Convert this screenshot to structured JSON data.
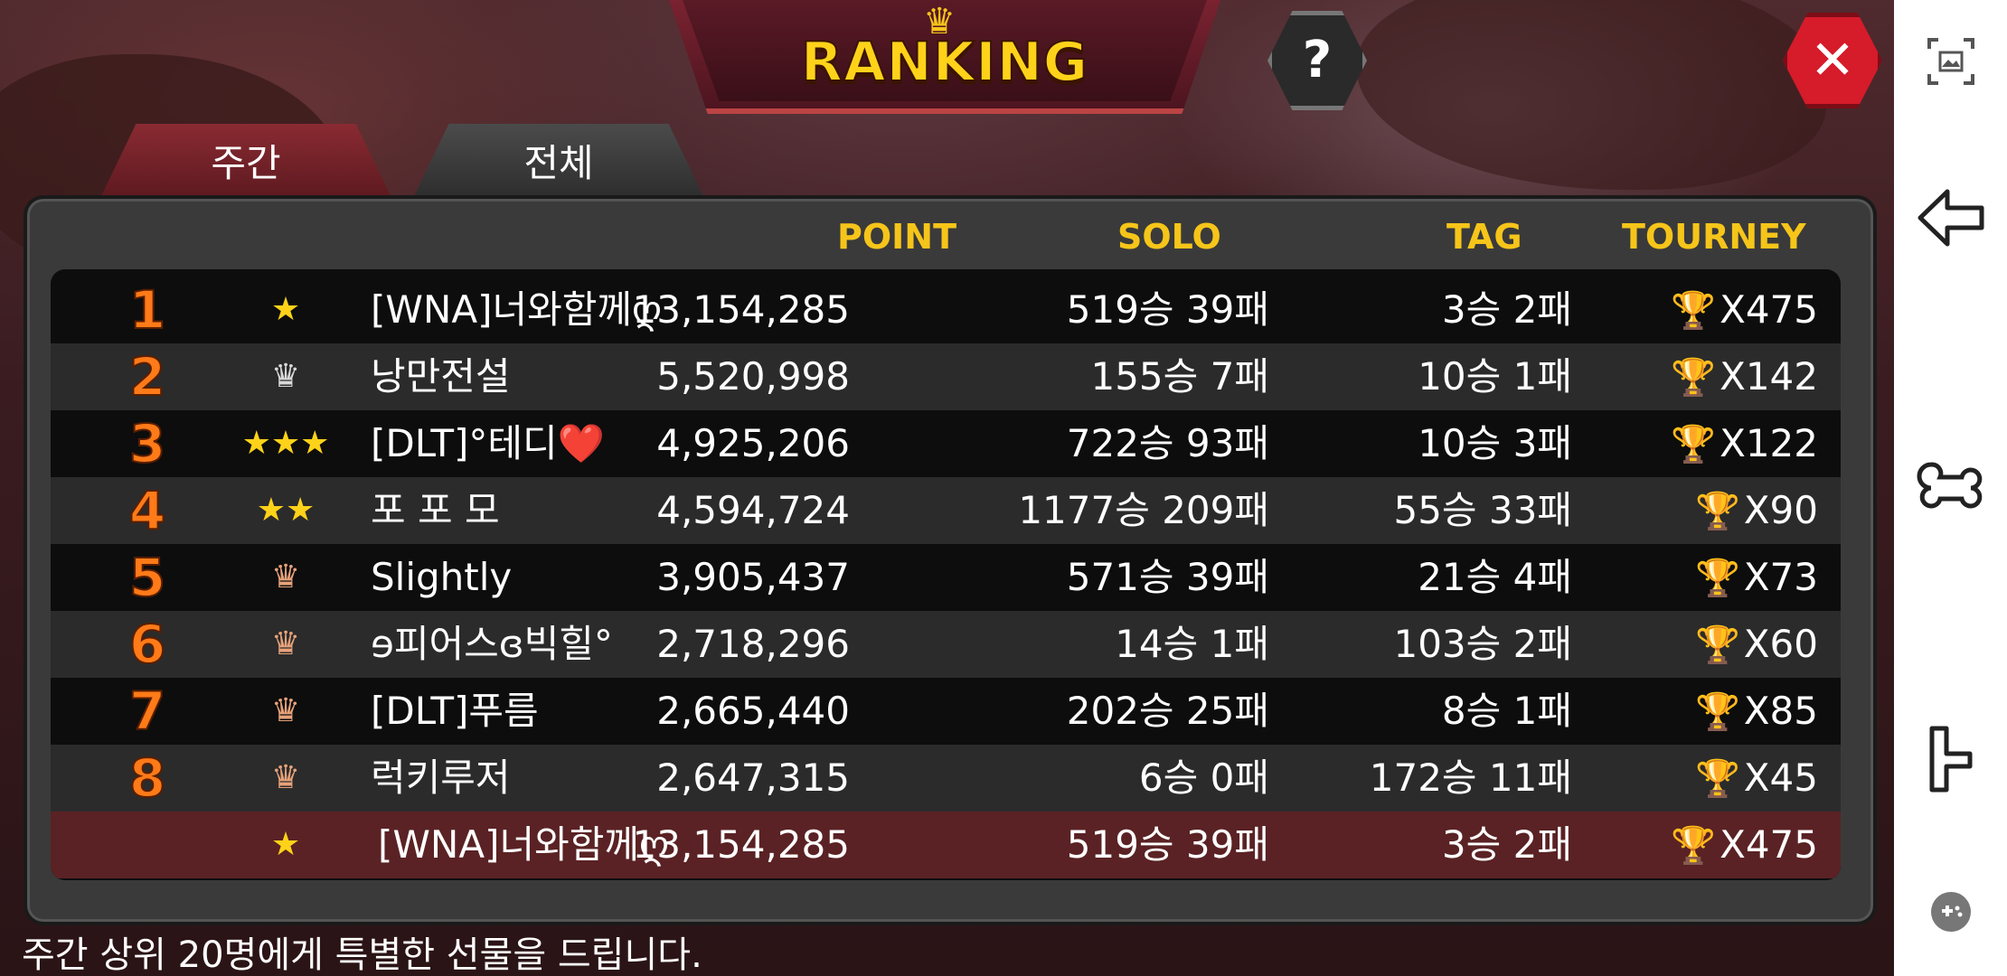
{
  "header": {
    "title": "RANKING",
    "help": "?",
    "close": "✕"
  },
  "tabs": [
    {
      "label": "주간"
    },
    {
      "label": "전체"
    }
  ],
  "columns": {
    "point": "POINT",
    "solo": "SOLO",
    "tag": "TAG",
    "tourney": "TOURNEY"
  },
  "rows": [
    {
      "rank": "1",
      "badge": "★",
      "badge_type": "star",
      "name": "[WNA]너와함께ღ",
      "point": "13,154,285",
      "solo": "519승 39패",
      "tag": "3승 2패",
      "tourney": "X475"
    },
    {
      "rank": "2",
      "badge": "♛",
      "badge_type": "crown-silver",
      "name": "낭만전설",
      "point": "5,520,998",
      "solo": "155승 7패",
      "tag": "10승 1패",
      "tourney": "X142"
    },
    {
      "rank": "3",
      "badge": "★★★",
      "badge_type": "star",
      "name": "[DLT]°테디❤️",
      "point": "4,925,206",
      "solo": "722승 93패",
      "tag": "10승 3패",
      "tourney": "X122"
    },
    {
      "rank": "4",
      "badge": "★★",
      "badge_type": "star",
      "name": "포 포 모",
      "point": "4,594,724",
      "solo": "1177승 209패",
      "tag": "55승 33패",
      "tourney": "X90"
    },
    {
      "rank": "5",
      "badge": "♛",
      "badge_type": "crown-bronze",
      "name": "Slightly",
      "point": "3,905,437",
      "solo": "571승 39패",
      "tag": "21승 4패",
      "tourney": "X73"
    },
    {
      "rank": "6",
      "badge": "♛",
      "badge_type": "crown-bronze",
      "name": "ɘ피어스ɞ빅힐°",
      "point": "2,718,296",
      "solo": "14승 1패",
      "tag": "103승 2패",
      "tourney": "X60"
    },
    {
      "rank": "7",
      "badge": "♛",
      "badge_type": "crown-bronze",
      "name": "[DLT]푸름",
      "point": "2,665,440",
      "solo": "202승 25패",
      "tag": "8승 1패",
      "tourney": "X85"
    },
    {
      "rank": "8",
      "badge": "♛",
      "badge_type": "crown-bronze",
      "name": "럭키루저",
      "point": "2,647,315",
      "solo": "6승 0패",
      "tag": "172승 11패",
      "tourney": "X45"
    }
  ],
  "my_row": {
    "badge": "★",
    "name": "[WNA]너와함께ღ",
    "point": "13,154,285",
    "solo": "519승 39패",
    "tag": "3승 2패",
    "tourney": "X475"
  },
  "footer": "주간 상위 20명에게 특별한 선물을 드립니다.",
  "colors": {
    "accent_gold": "#ffd21a",
    "rank_orange": "#ff7a18",
    "close_red": "#d61b2a"
  }
}
